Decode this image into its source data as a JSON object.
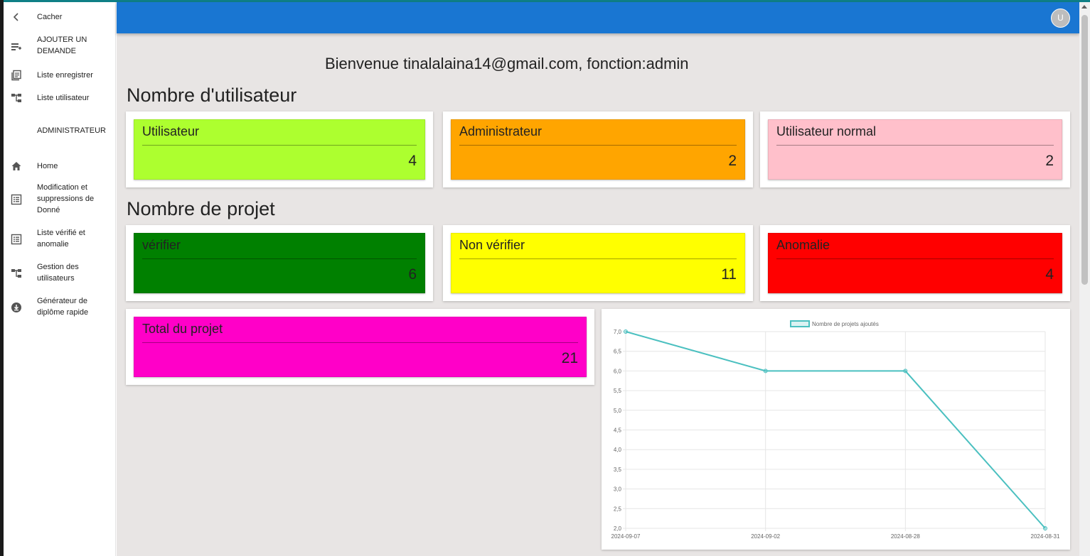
{
  "sidebar": {
    "hide_label": "Cacher",
    "items": [
      {
        "label": "AJOUTER UN DEMANDE",
        "icon": "add-queue-icon"
      },
      {
        "label": "Liste enregistrer",
        "icon": "library-books-icon"
      },
      {
        "label": "Liste utilisateur",
        "icon": "account-tree-icon"
      }
    ],
    "section_label": "ADMINISTRATEUR",
    "admin_items": [
      {
        "label": "Home",
        "icon": "home-icon"
      },
      {
        "label": "Modification et suppressions de Donné",
        "icon": "list-alt-icon"
      },
      {
        "label": "Liste vérifié et anomalie",
        "icon": "list-alt-icon"
      },
      {
        "label": "Gestion des utilisateurs",
        "icon": "account-tree-icon"
      },
      {
        "label": "Générateur de diplôme rapide",
        "icon": "download-circle-icon"
      }
    ]
  },
  "appbar": {
    "avatar_letter": "U",
    "color": "#1976d2"
  },
  "welcome": "Bienvenue tinalalaina14@gmail.com, fonction:admin",
  "users_section": {
    "title": "Nombre d'utilisateur",
    "cards": [
      {
        "title": "Utilisateur",
        "value": "4",
        "color": "#adff2f"
      },
      {
        "title": "Administrateur",
        "value": "2",
        "color": "#ffa500"
      },
      {
        "title": "Utilisateur normal",
        "value": "2",
        "color": "#ffc0cb"
      }
    ]
  },
  "projects_section": {
    "title": "Nombre de projet",
    "cards": [
      {
        "title": "vérifier",
        "value": "6",
        "color": "#008000"
      },
      {
        "title": "Non vérifier",
        "value": "11",
        "color": "#ffff00"
      },
      {
        "title": "Anomalie",
        "value": "4",
        "color": "#ff0000"
      }
    ],
    "total": {
      "title": "Total du projet",
      "value": "21",
      "color": "#ff00c8"
    }
  },
  "chart_data": {
    "type": "line",
    "categories": [
      "2024-09-07",
      "2024-09-02",
      "2024-08-28",
      "2024-08-31"
    ],
    "series": [
      {
        "name": "Nombre de projets ajoutés",
        "values": [
          7,
          6,
          6,
          2
        ],
        "color": "#4bc0c0"
      }
    ],
    "ylim": [
      2,
      7
    ],
    "yticks": [
      "7,0",
      "6,5",
      "6,0",
      "5,5",
      "5,0",
      "4,5",
      "4,0",
      "3,5",
      "3,0",
      "2,5",
      "2,0"
    ],
    "legend": "top",
    "grid": true
  }
}
